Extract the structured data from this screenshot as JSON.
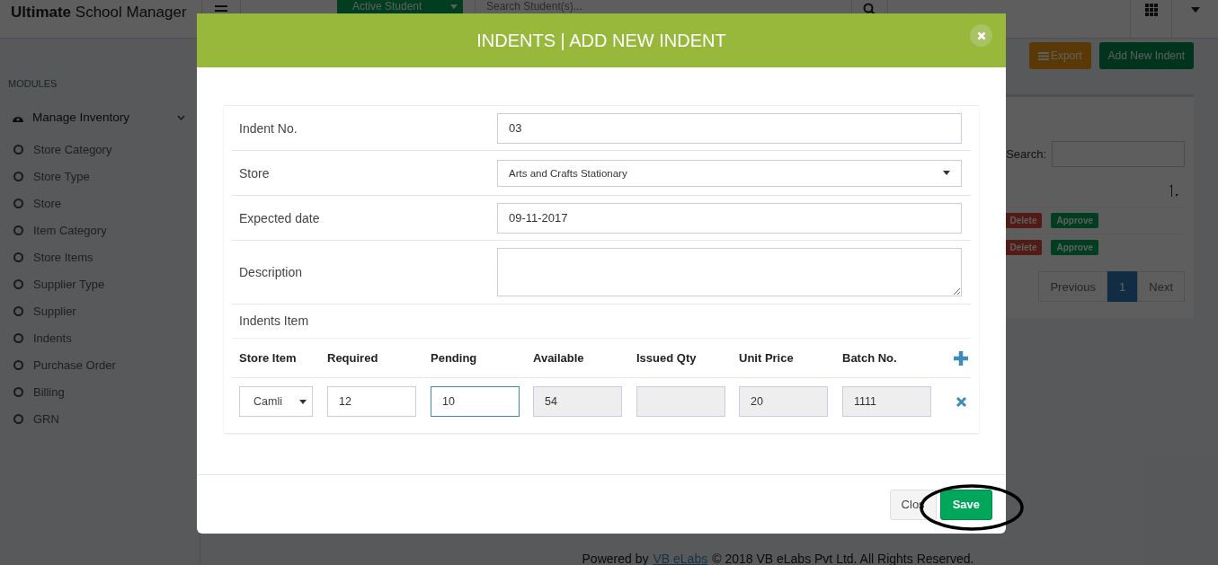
{
  "app": {
    "brand": "**Ultimate** School Manager",
    "student_filter": "Active Student",
    "search": {
      "placeholder": "Search Student(s)..."
    }
  },
  "sidebar": {
    "heading": "MODULES",
    "group": {
      "label": "Manage Inventory",
      "expanded": true,
      "items": [
        "Store Category",
        "Store Type",
        "Store",
        "Item Category",
        "Store Items",
        "Supplier Type",
        "Supplier",
        "Indents",
        "Purchase Order",
        "Billing",
        "GRN"
      ]
    }
  },
  "toolbar": {
    "buttons": [
      {
        "label": "Export",
        "kind": "export"
      },
      {
        "label": "Add New Indent",
        "kind": "add"
      }
    ]
  },
  "list": {
    "search_label": "Search:",
    "rows": [
      {
        "actions": [
          {
            "label": "Delete",
            "kind": "delete"
          },
          {
            "label": "Approve",
            "kind": "approve"
          }
        ]
      },
      {
        "actions": [
          {
            "label": "Delete",
            "kind": "delete"
          },
          {
            "label": "Approve",
            "kind": "approve"
          }
        ]
      }
    ],
    "pagination": [
      {
        "label": "Previous",
        "selected": false
      },
      {
        "label": "1",
        "selected": true
      },
      {
        "label": "Next",
        "selected": false
      }
    ]
  },
  "modal": {
    "title": "INDENTS | ADD NEW INDENT",
    "fields": [
      {
        "label": "Indent No.",
        "kind": "text",
        "value": "03"
      },
      {
        "label": "Store",
        "kind": "select",
        "value": "Arts and Crafts Stationary"
      },
      {
        "label": "Expected date",
        "kind": "text",
        "value": "09-11-2017"
      },
      {
        "label": "Description",
        "kind": "textarea"
      }
    ],
    "items_heading": "Indents Item",
    "columns": [
      "Store Item",
      "Required",
      "Pending",
      "Available",
      "Issued Qty",
      "Unit Price",
      "Batch No."
    ],
    "rows": [
      {
        "cells": [
          {
            "kind": "select",
            "value": "Camli"
          },
          {
            "kind": "input",
            "value": "12",
            "focused": false
          },
          {
            "kind": "input",
            "value": "10",
            "focused": true
          },
          {
            "kind": "readonly",
            "value": "54"
          },
          {
            "kind": "readonly"
          },
          {
            "kind": "readonly",
            "value": "20"
          },
          {
            "kind": "readonly",
            "value": "1111"
          }
        ]
      }
    ],
    "buttons": [
      {
        "label": "Clos",
        "kind": "default"
      },
      {
        "label": "Save",
        "kind": "primary"
      }
    ]
  },
  "annotation": {
    "kind": "ellipse"
  },
  "footer": {
    "prefix": "Powered by",
    "link": "VB eLabs",
    "suffix": "© 2018 VB eLabs Pvt Ltd. All Rights Reserved."
  }
}
